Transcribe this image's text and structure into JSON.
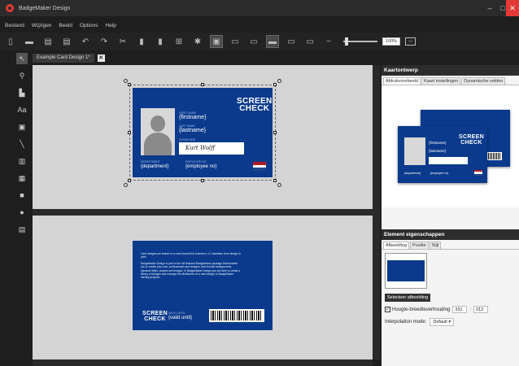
{
  "window": {
    "title": "BadgeMaker Design",
    "minimize": "–",
    "maximize": "□",
    "close": "✕"
  },
  "menu": [
    "Bestand",
    "Wijzigen",
    "Beeld",
    "Options",
    "Help"
  ],
  "toolbar": {
    "zoom_value": "100%",
    "fit_label": "▭"
  },
  "document_tab": {
    "label": "Example Card Design 1*",
    "close": "✕"
  },
  "card_front": {
    "logo_top": "SCREEN",
    "logo_bottom": "CHECK",
    "firstname_label": "FIRST NAME",
    "firstname_value": "{firstname}",
    "lastname_label": "LAST NAME",
    "lastname_value": "{lastname}",
    "signature_label": "SIGNATURE",
    "signature_value": "Kurt Wolff",
    "department_label": "DEPARTMENT",
    "department_value": "{department}",
    "employee_label": "EMPLOYEE NO",
    "employee_value": "{employee no}",
    "flag_colors": [
      "#ae1c28",
      "#ffffff",
      "#21468b"
    ]
  },
  "card_back": {
    "paragraph1": "Card designs are based on a new format that ensures a 1:1 transition from design to print.",
    "paragraph2": "BadgeMaker Design is part of the full featured BadgeMaker package that enables you to create your own, professional card designs, that include backgrounds, dynamic fields, shapes and images. In BadgeMaker Design you are able to create a library of designs and manage the distribution of a card design to BadgeMaker Identity projects.",
    "valid_label": "VALID UNTIL",
    "valid_value": "{valid until}",
    "logo_top": "SCREEN",
    "logo_bottom": "CHECK"
  },
  "kaartontwerp": {
    "title": "Kaartontwerp",
    "tabs": [
      "Afdrukvoorbeeld",
      "Kaart instellingen",
      "Dynamische velden"
    ],
    "mini_firstname": "{firstname}",
    "mini_lastname": "{lastname}",
    "mini_department": "{department}",
    "mini_employee": "{employee no}"
  },
  "element_eigenschappen": {
    "title": "Element eigenschappen",
    "tabs": [
      "Afbeelding",
      "Positie",
      "Stijl"
    ],
    "select_button": "Selecteer afbeelding",
    "ratio_label": "Hoogte-breedteverhouding",
    "ratio_checked": "✓",
    "width_value": "331",
    "height_value": "212",
    "ratio_separator": ":",
    "interpolation_label": "Interpolation mode:",
    "interpolation_value": "Default"
  },
  "colors": {
    "card_blue": "#0b3a8c",
    "accent_red": "#e53935",
    "canvas_gray": "#d4d4d4"
  }
}
